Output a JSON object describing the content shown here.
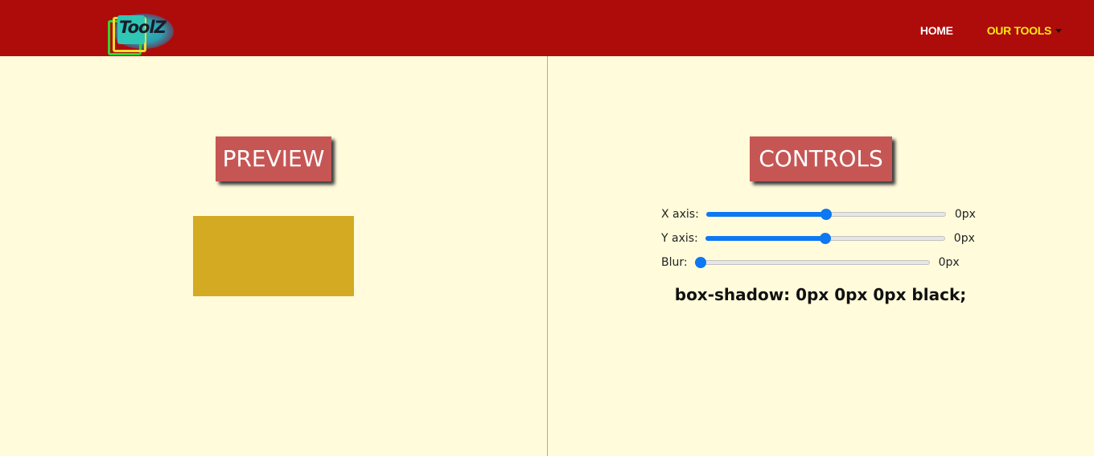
{
  "header": {
    "logo_text": "ToolZ",
    "nav": {
      "home_label": "HOME",
      "tools_label": "OUR TOOLS"
    }
  },
  "preview": {
    "title": "PREVIEW",
    "box_color": "#d3aa22"
  },
  "controls": {
    "title": "CONTROLS",
    "sliders": [
      {
        "label": "X axis:",
        "value_text": "0px",
        "position": 0.5
      },
      {
        "label": "Y axis:",
        "value_text": "0px",
        "position": 0.5
      },
      {
        "label": "Blur:",
        "value_text": "0px",
        "position": 0.0
      }
    ],
    "output": "box-shadow: 0px 0px 0px black;"
  },
  "colors": {
    "header_bg": "#ad0c0b",
    "page_bg": "#fffbdb",
    "title_bg": "#c65654",
    "accent": "#0d78f2",
    "nav_active": "#ffe812"
  }
}
